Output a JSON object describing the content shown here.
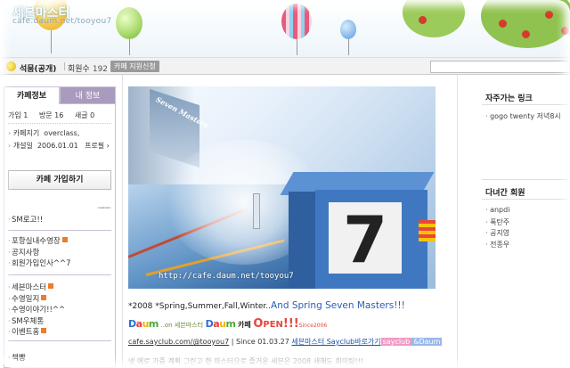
{
  "banner": {
    "title": "세븐마스터",
    "url": "cafe.daum.net/tooyou7"
  },
  "navbar": {
    "grade": "석뭄(공개)",
    "members_label": "회원수",
    "members_count": "192",
    "small_button": "카페 지원신청"
  },
  "sidebar": {
    "tabs": [
      {
        "label": "카페정보"
      },
      {
        "label": "내 정보"
      }
    ],
    "stats": {
      "level": "가입 1",
      "visits": "방문 16",
      "posts": "새글 0"
    },
    "manager_label": "카페지기",
    "manager_value": "overclass,",
    "founded_label": "개설일",
    "founded_value": "2006.01.01",
    "profile_label": "프로필",
    "join_button": "카페 가입하기",
    "player_ctl": "재생",
    "menu_group1": [
      {
        "label": "SM로고!!",
        "new": false
      }
    ],
    "menu_group2": [
      {
        "label": "포항실내수영장",
        "new": true
      },
      {
        "label": "공지사항",
        "new": false
      },
      {
        "label": "회원가입인사^^7",
        "new": false
      }
    ],
    "menu_group3": [
      {
        "label": "세븐마스터",
        "new": true
      },
      {
        "label": "수영일지",
        "new": true
      },
      {
        "label": "수영이야기!!^^",
        "new": false
      },
      {
        "label": "SM우체통",
        "new": false
      },
      {
        "label": "이벤트홈",
        "new": true
      }
    ],
    "menu_group4": [
      {
        "label": "책빵",
        "new": false
      }
    ]
  },
  "main": {
    "photo_url_text": "http://cafe.daum.net/tooyou7",
    "photo_banner_text": "Seven Masters",
    "lane_number": "7",
    "line1_small": "*2008 *Spring,Summer,Fall,Winter..",
    "line1_big": "And Spring Seven Masters!!!",
    "line2": {
      "daum1": [
        "D",
        "a",
        "u",
        "m"
      ],
      "daum1_suffix": "..on 세븐마스터",
      "daum2": [
        "D",
        "a",
        "u",
        "m"
      ],
      "cafe_word": "카페",
      "open_o": "O",
      "open_rest": "PEN",
      "open_exc": "!!!",
      "since": "Since2006"
    },
    "line3": {
      "link1": "cafe.sayclub.com/@tooyou7",
      "since": "Since 01.03.27",
      "link2": "세븐마스터 Sayclub바로가기",
      "tag1": "sayclub",
      "tag2": "&Daum"
    },
    "line4": "넷 에로 가중 계획 그린고 한 마스터으로 즐거운 세븐은 2008 새해도 회이팅!!!"
  },
  "right": {
    "links_title": "자주가는 링크",
    "links": [
      "· gogo twenty 저녁8시"
    ],
    "visitors_title": "다녀간 회원",
    "visitors": [
      "· anpdi",
      "· 폭탄주",
      "· 공지영",
      "· 전종우"
    ]
  },
  "colors": {
    "tab_inactive": "#a99bbd",
    "border": "#c9c0d6",
    "new_badge": "#f07b28"
  }
}
